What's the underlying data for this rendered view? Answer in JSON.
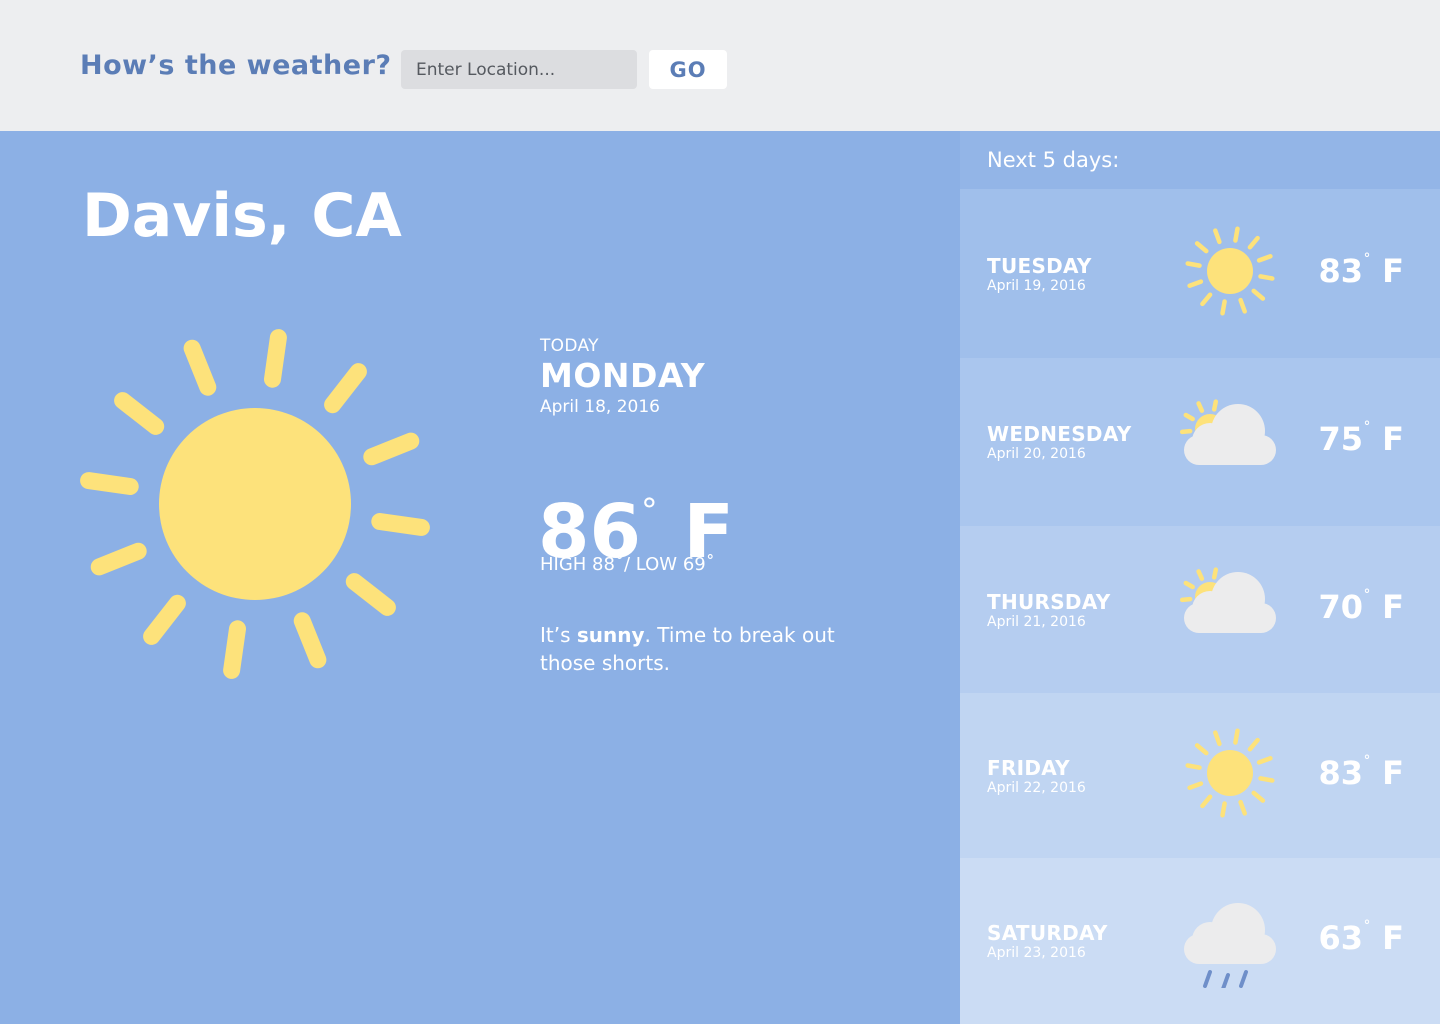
{
  "header": {
    "title": "How’s the weather?",
    "search_placeholder": "Enter Location...",
    "go_label": "GO"
  },
  "current": {
    "city": "Davis, CA",
    "today_label": "TODAY",
    "day": "MONDAY",
    "date": "April 18, 2016",
    "temp": "86",
    "deg_symbol": "°",
    "unit": "F",
    "hilo": "HIGH 88˚/ LOW 69˚",
    "desc_prefix": "It’s ",
    "desc_bold": "sunny",
    "desc_suffix": ". Time to break out those shorts.",
    "icon": "sun-icon"
  },
  "forecast": {
    "heading": "Next 5 days:",
    "deg_symbol": "˚",
    "unit": "F",
    "days": [
      {
        "name": "TUESDAY",
        "date": "April 19, 2016",
        "temp": "83",
        "icon": "sun-icon"
      },
      {
        "name": "WEDNESDAY",
        "date": "April 20, 2016",
        "temp": "75",
        "icon": "partly-cloudy-icon"
      },
      {
        "name": "THURSDAY",
        "date": "April 21, 2016",
        "temp": "70",
        "icon": "partly-cloudy-icon"
      },
      {
        "name": "FRIDAY",
        "date": "April 22, 2016",
        "temp": "83",
        "icon": "sun-icon"
      },
      {
        "name": "SATURDAY",
        "date": "April 23, 2016",
        "temp": "63",
        "icon": "rain-cloud-icon"
      }
    ]
  },
  "colors": {
    "header_bg": "#edeef0",
    "brand": "#5b7db6",
    "main_bg": "#8cb0e5",
    "sidebar_bg": "#93b5e7",
    "row_bgs": [
      "#a0bfeb",
      "#aac6ee",
      "#b5cdf0",
      "#c0d5f2",
      "#cbdcf4"
    ],
    "sun": "#fde27b",
    "cloud": "#ececed",
    "rain": "#6f8fc9"
  }
}
